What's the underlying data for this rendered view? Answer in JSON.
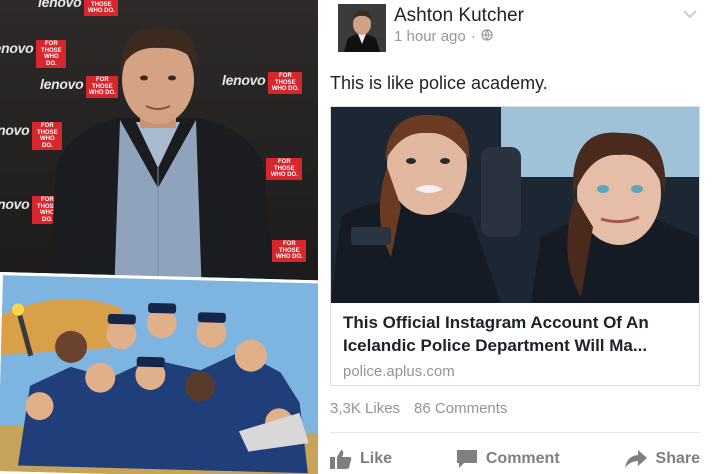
{
  "collage": {
    "backdrop_brand": "lenovo",
    "backdrop_tag": "FOR THOSE WHO DO."
  },
  "post": {
    "author": "Ashton Kutcher",
    "timestamp": "1 hour ago",
    "visibility_icon": "globe-icon",
    "text": "This is like police academy.",
    "link": {
      "title": "This Official Instagram Account Of An Icelandic Police Department Will Ma...",
      "domain": "police.aplus.com"
    },
    "stats": {
      "likes": "3,3K Likes",
      "comments": "86 Comments"
    },
    "actions": {
      "like": "Like",
      "comment": "Comment",
      "share": "Share"
    }
  },
  "colors": {
    "brand_red": "#d7262c",
    "meta_gray": "#9197a3",
    "action_gray": "#7f7f7f"
  }
}
